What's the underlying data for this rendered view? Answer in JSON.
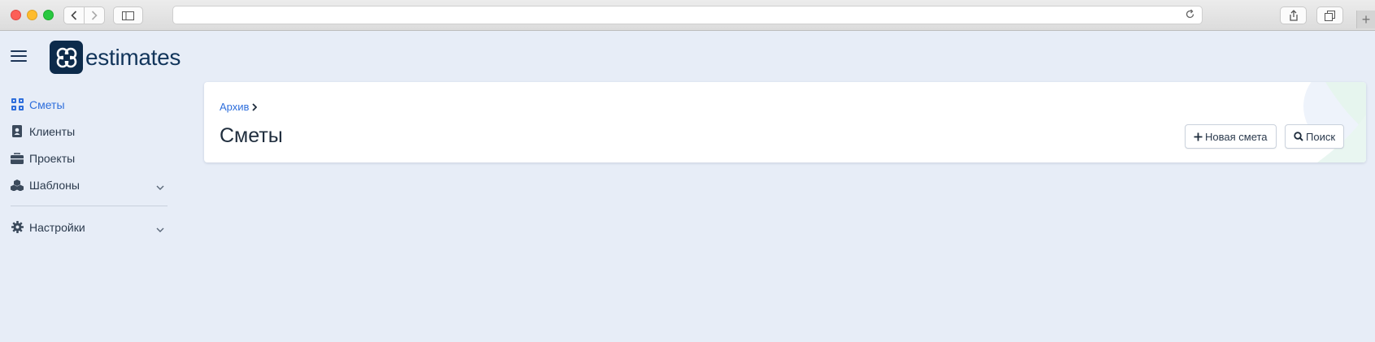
{
  "app": {
    "logo_text": "estimates"
  },
  "nav": {
    "items": [
      {
        "label": "Сметы",
        "icon": "grid-icon",
        "active": true
      },
      {
        "label": "Клиенты",
        "icon": "contact-book-icon",
        "active": false
      },
      {
        "label": "Проекты",
        "icon": "briefcase-icon",
        "active": false
      },
      {
        "label": "Шаблоны",
        "icon": "cubes-icon",
        "active": false,
        "expandable": true
      },
      {
        "label": "Настройки",
        "icon": "gear-icon",
        "active": false,
        "expandable": true
      }
    ]
  },
  "page": {
    "breadcrumb": "Архив",
    "title": "Сметы",
    "actions": {
      "new_label": "Новая смета",
      "search_label": "Поиск"
    }
  },
  "colors": {
    "accent": "#2f6fdc",
    "background": "#e7edf7",
    "brand": "#0d2b4b"
  }
}
